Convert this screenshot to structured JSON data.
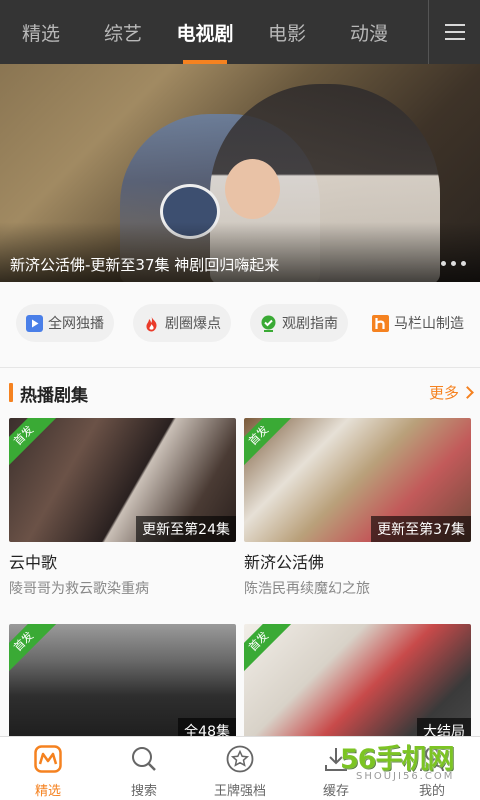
{
  "top_tabs": [
    {
      "label": "精选",
      "active": false
    },
    {
      "label": "综艺",
      "active": false
    },
    {
      "label": "电视剧",
      "active": true
    },
    {
      "label": "电影",
      "active": false
    },
    {
      "label": "动漫",
      "active": false
    }
  ],
  "banner": {
    "caption": "新济公活佛-更新至37集 神剧回归嗨起来",
    "page_count": 3
  },
  "quick_links": [
    {
      "label": "全网独播",
      "icon": "play-square-icon",
      "color": "#4a7fe8"
    },
    {
      "label": "剧圈爆点",
      "icon": "flame-icon",
      "color": "#ea3b2a"
    },
    {
      "label": "观剧指南",
      "icon": "guide-check-icon",
      "color": "#3aaa35"
    },
    {
      "label": "马栏山制造",
      "icon": "h-logo-icon",
      "color": "#f58220"
    }
  ],
  "section": {
    "title": "热播剧集",
    "more_label": "更多"
  },
  "cards": [
    {
      "badge": "首发",
      "update": "更新至第24集",
      "title": "云中歌",
      "desc": "陵哥哥为救云歌染重病"
    },
    {
      "badge": "首发",
      "update": "更新至第37集",
      "title": "新济公活佛",
      "desc": "陈浩民再续魔幻之旅"
    },
    {
      "badge": "首发",
      "update": "全48集",
      "title": "",
      "desc": ""
    },
    {
      "badge": "首发",
      "update": "大结局",
      "title": "",
      "desc": ""
    }
  ],
  "bottom_nav": [
    {
      "label": "精选",
      "icon": "mango-tv-icon",
      "active": true
    },
    {
      "label": "搜索",
      "icon": "search-icon",
      "active": false
    },
    {
      "label": "王牌强档",
      "icon": "star-badge-icon",
      "active": false
    },
    {
      "label": "缓存",
      "icon": "download-icon",
      "active": false
    },
    {
      "label": "我的",
      "icon": "user-icon",
      "active": false
    }
  ],
  "watermark": {
    "main": "56手机网",
    "sub": "SHOUJI56.COM"
  },
  "colors": {
    "accent": "#f58220",
    "badge": "#3aaa35",
    "topbar": "#343434"
  }
}
